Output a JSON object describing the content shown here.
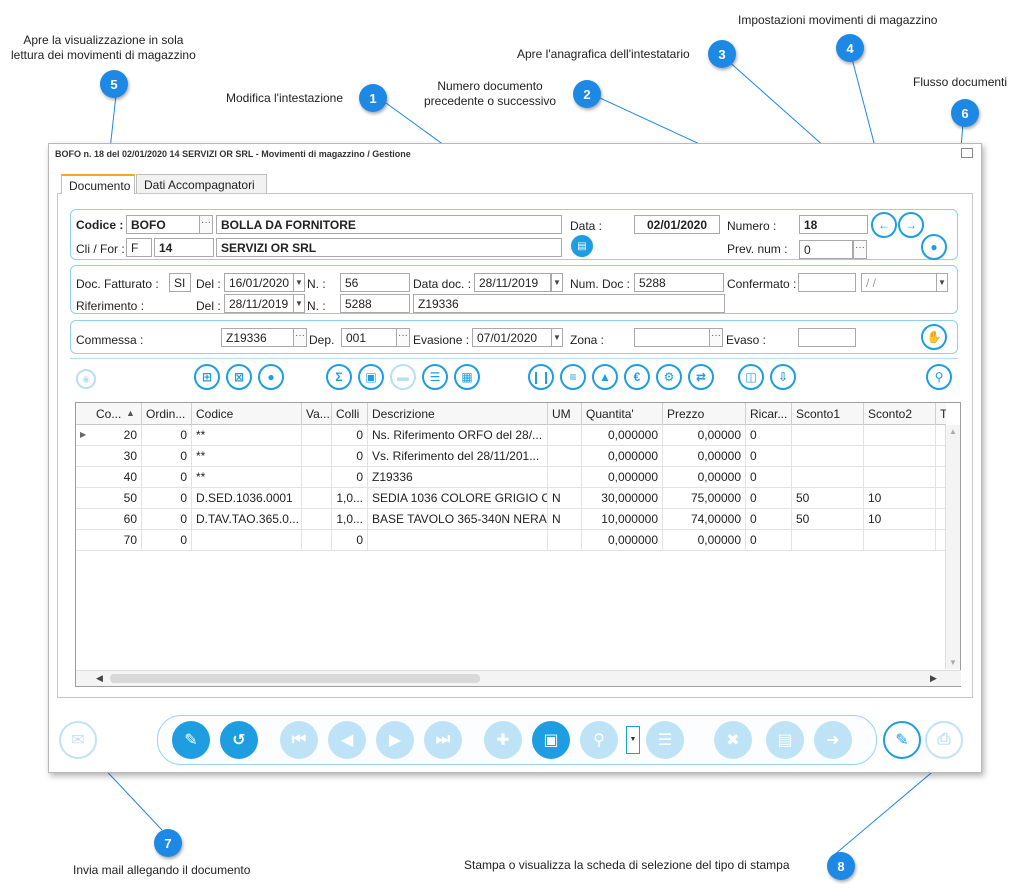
{
  "callouts": [
    {
      "num": "1",
      "text": "Modifica l'intestazione"
    },
    {
      "num": "2",
      "text": "Numero documento\nprecedente o successivo"
    },
    {
      "num": "3",
      "text": "Apre l'anagrafica dell'intestatario"
    },
    {
      "num": "4",
      "text": "Impostazioni movimenti di magazzino"
    },
    {
      "num": "5",
      "text": "Apre la visualizzazione in sola\nlettura dei movimenti di magazzino"
    },
    {
      "num": "6",
      "text": "Flusso documenti"
    },
    {
      "num": "7",
      "text": "Invia mail allegando il documento"
    },
    {
      "num": "8",
      "text": "Stampa o visualizza la scheda di selezione del tipo di stampa"
    }
  ],
  "window": {
    "title": "BOFO n. 18 del 02/01/2020 14 SERVIZI OR SRL - Movimenti di magazzino / Gestione"
  },
  "tabs": [
    {
      "label": "Documento",
      "active": true
    },
    {
      "label": "Dati Accompagnatori",
      "active": false
    }
  ],
  "header": {
    "codice_label": "Codice :",
    "codice_value": "BOFO",
    "codice_desc": "BOLLA DA FORNITORE",
    "data_label": "Data :",
    "data_value": "02/01/2020",
    "numero_label": "Numero :",
    "numero_value": "18",
    "clifor_label": "Cli / For :",
    "clifor_type": "F",
    "clifor_code": "14",
    "clifor_desc": "SERVIZI OR SRL",
    "prevnum_label": "Prev. num :",
    "prevnum_value": "0"
  },
  "docinfo": {
    "fatturato_label": "Doc. Fatturato :",
    "fatturato_value": "SI",
    "del1_label": "Del :",
    "del1_value": "16/01/2020",
    "n1_label": "N. :",
    "n1_value": "56",
    "datadoc_label": "Data doc. :",
    "datadoc_value": "28/11/2019",
    "numdoc_label": "Num. Doc :",
    "numdoc_value": "5288",
    "confermato_label": "Confermato :",
    "confermato_value": "",
    "confermato_date": " /  / ",
    "riferimento_label": "Riferimento :",
    "del2_label": "Del :",
    "del2_value": "28/11/2019",
    "n2_label": "N. :",
    "n2_value": "5288",
    "rif_text": "Z19336"
  },
  "commessa": {
    "commessa_label": "Commessa :",
    "commessa_value": "Z19336",
    "dep_label": "Dep.",
    "dep_value": "001",
    "evasione_label": "Evasione :",
    "evasione_value": "07/01/2020",
    "zona_label": "Zona :",
    "zona_value": "",
    "evaso_label": "Evaso :",
    "evaso_value": ""
  },
  "grid": {
    "columns": [
      "Co...",
      "Ordin...",
      "Codice",
      "Va...",
      "Colli",
      "Descrizione",
      "UM",
      "Quantita'",
      "Prezzo",
      "Ricar...",
      "Sconto1",
      "Sconto2",
      "T"
    ],
    "rows": [
      [
        "20",
        "0",
        "**",
        "",
        "0",
        "Ns. Riferimento ORFO del 28/...",
        "",
        "0,000000",
        "0,00000",
        "0",
        "",
        ""
      ],
      [
        "30",
        "0",
        "**",
        "",
        "0",
        "Vs. Riferimento del 28/11/201...",
        "",
        "0,000000",
        "0,00000",
        "0",
        "",
        ""
      ],
      [
        "40",
        "0",
        "**",
        "",
        "0",
        "Z19336",
        "",
        "0,000000",
        "0,00000",
        "0",
        "",
        ""
      ],
      [
        "50",
        "0",
        "D.SED.1036.0001",
        "",
        "1,0...",
        "SEDIA 1036 COLORE GRIGIO C...",
        "N",
        "30,000000",
        "75,00000",
        "0",
        "50",
        "10"
      ],
      [
        "60",
        "0",
        "D.TAV.TAO.365.0...",
        "",
        "1,0...",
        "BASE TAVOLO 365-340N NERA",
        "N",
        "10,000000",
        "74,00000",
        "0",
        "50",
        "10"
      ],
      [
        "70",
        "0",
        "",
        "",
        "0",
        "",
        "",
        "0,000000",
        "0,00000",
        "0",
        "",
        ""
      ]
    ]
  },
  "colors": {
    "accent": "#1e9de0",
    "badge": "#1e88e5",
    "disabled": "#bfe3f6",
    "tab_active": "#f5a623"
  }
}
